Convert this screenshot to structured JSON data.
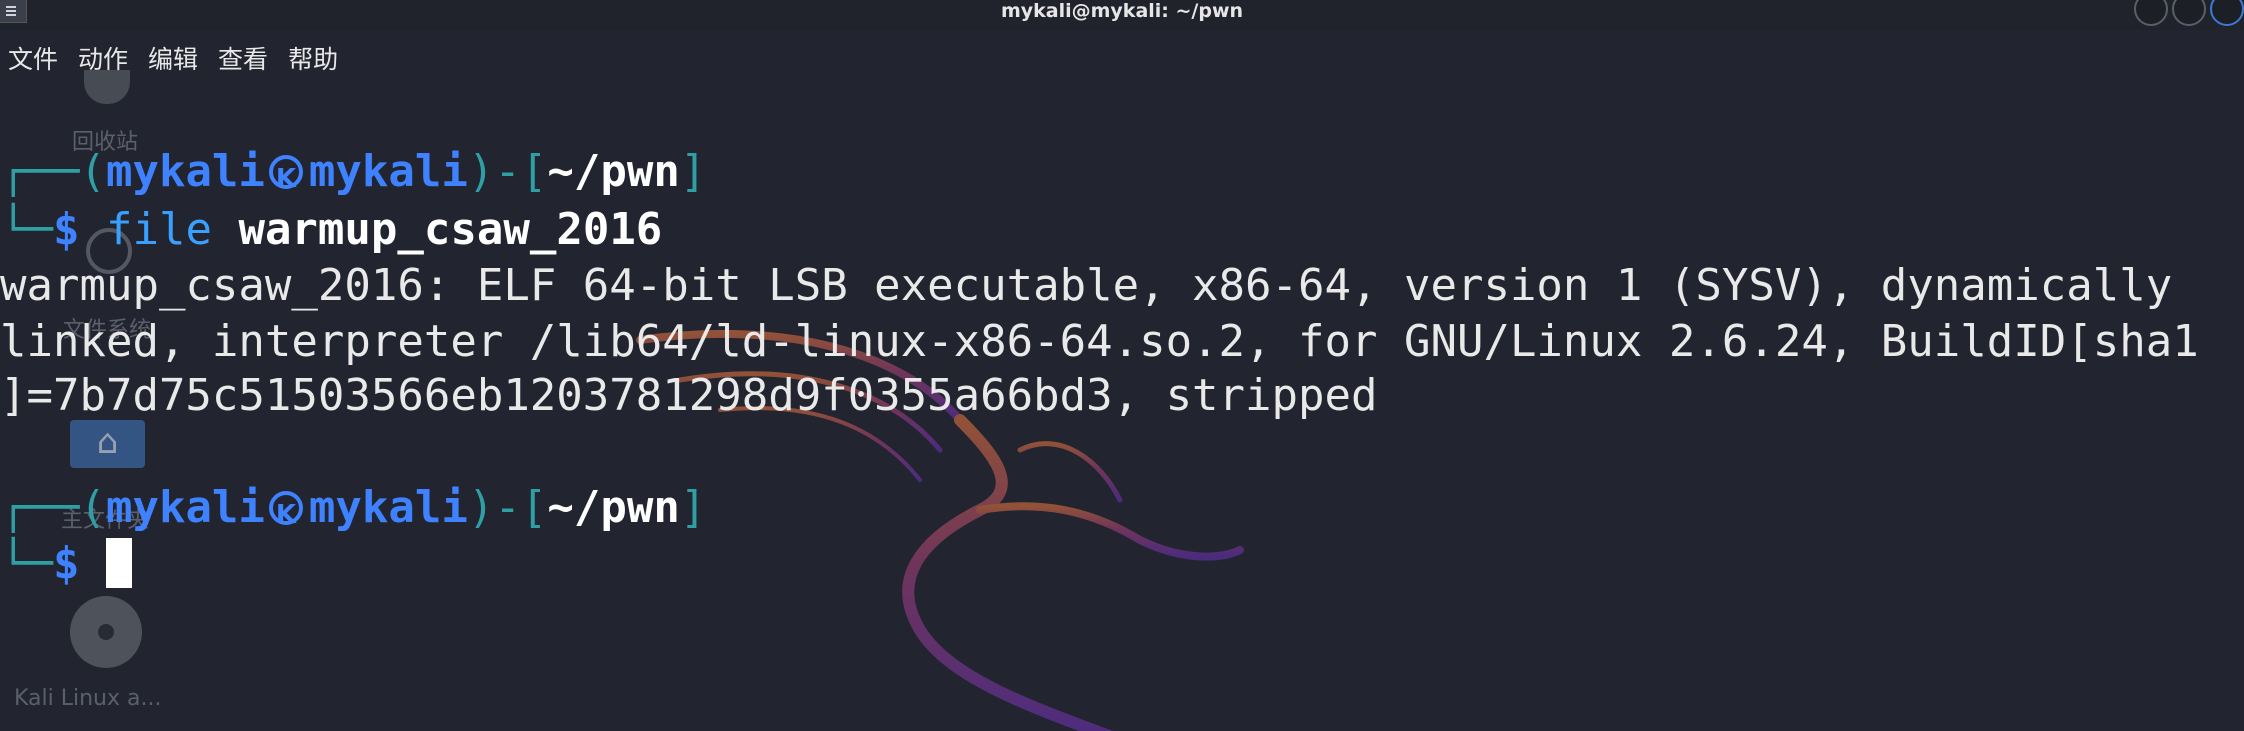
{
  "window": {
    "title": "mykali@mykali: ~/pwn"
  },
  "menubar": {
    "items": [
      "文件",
      "动作",
      "编辑",
      "查看",
      "帮助"
    ]
  },
  "desktop_icons": {
    "trash": "回收站",
    "filesystem": "文件系统",
    "home": "主文件夹",
    "disc": "Kali Linux a..."
  },
  "terminal": {
    "prompt1": {
      "user": "mykali",
      "host": "mykali",
      "path": "~/pwn"
    },
    "command": {
      "name": "file",
      "arg": "warmup_csaw_2016"
    },
    "output": [
      "warmup_csaw_2016: ELF 64-bit LSB executable, x86-64, version 1 (SYSV), dynamically",
      "linked, interpreter /lib64/ld-linux-x86-64.so.2, for GNU/Linux 2.6.24, BuildID[sha1",
      "]=7b7d75c51503566eb1203781298d9f0355a66bd3, stripped"
    ],
    "prompt2": {
      "user": "mykali",
      "host": "mykali",
      "path": "~/pwn"
    },
    "dollar": "$"
  },
  "colors": {
    "background": "#22252f",
    "prompt_user": "#3f82ff",
    "prompt_corner": "#2f9fa6",
    "text": "#e9e9e9"
  }
}
